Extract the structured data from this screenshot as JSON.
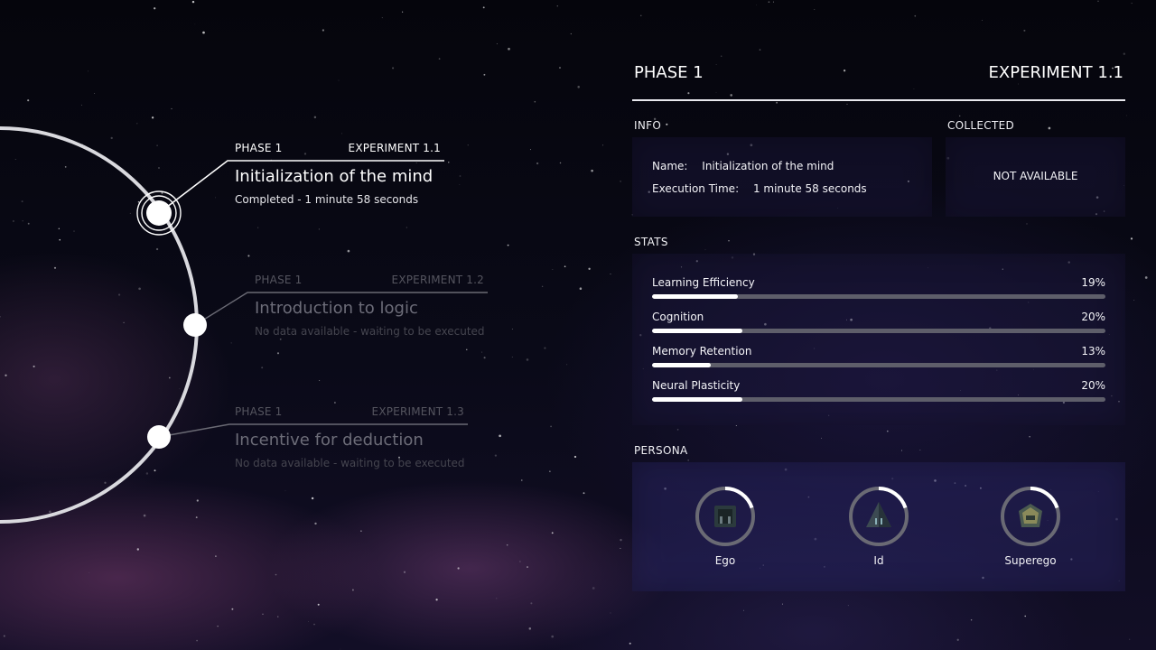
{
  "timeline": {
    "entries": [
      {
        "phase": "PHASE 1",
        "experiment": "EXPERIMENT 1.1",
        "title": "Initialization of the mind",
        "status": "Completed - 1 minute 58 seconds",
        "active": true
      },
      {
        "phase": "PHASE 1",
        "experiment": "EXPERIMENT 1.2",
        "title": "Introduction to logic",
        "status": "No data available - waiting to be executed",
        "active": false
      },
      {
        "phase": "PHASE 1",
        "experiment": "EXPERIMENT 1.3",
        "title": "Incentive for deduction",
        "status": "No data available - waiting to be executed",
        "active": false
      }
    ]
  },
  "panel": {
    "phase": "PHASE 1",
    "experiment": "EXPERIMENT 1.1",
    "info": {
      "label": "INFO",
      "name_key": "Name:",
      "name_value": "Initialization of the mind",
      "time_key": "Execution Time:",
      "time_value": "1 minute 58 seconds"
    },
    "collected": {
      "label": "COLLECTED",
      "value": "NOT AVAILABLE"
    },
    "stats": {
      "label": "STATS",
      "items": [
        {
          "name": "Learning Efficiency",
          "percent": "19%",
          "value": 19
        },
        {
          "name": "Cognition",
          "percent": "20%",
          "value": 20
        },
        {
          "name": "Memory Retention",
          "percent": "13%",
          "value": 13
        },
        {
          "name": "Neural Plasticity",
          "percent": "20%",
          "value": 20
        }
      ]
    },
    "persona": {
      "label": "PERSONA",
      "items": [
        {
          "name": "Ego",
          "icon": "ego-icon",
          "progress": 0.2
        },
        {
          "name": "Id",
          "icon": "id-pyramid-icon",
          "progress": 0.2
        },
        {
          "name": "Superego",
          "icon": "superego-icon",
          "progress": 0.2
        }
      ]
    }
  },
  "colors": {
    "accent": "#ffffff",
    "inactive_text": "#55555f",
    "panel_bg": "#1c183e",
    "bar_track": "#5e5e6a"
  }
}
